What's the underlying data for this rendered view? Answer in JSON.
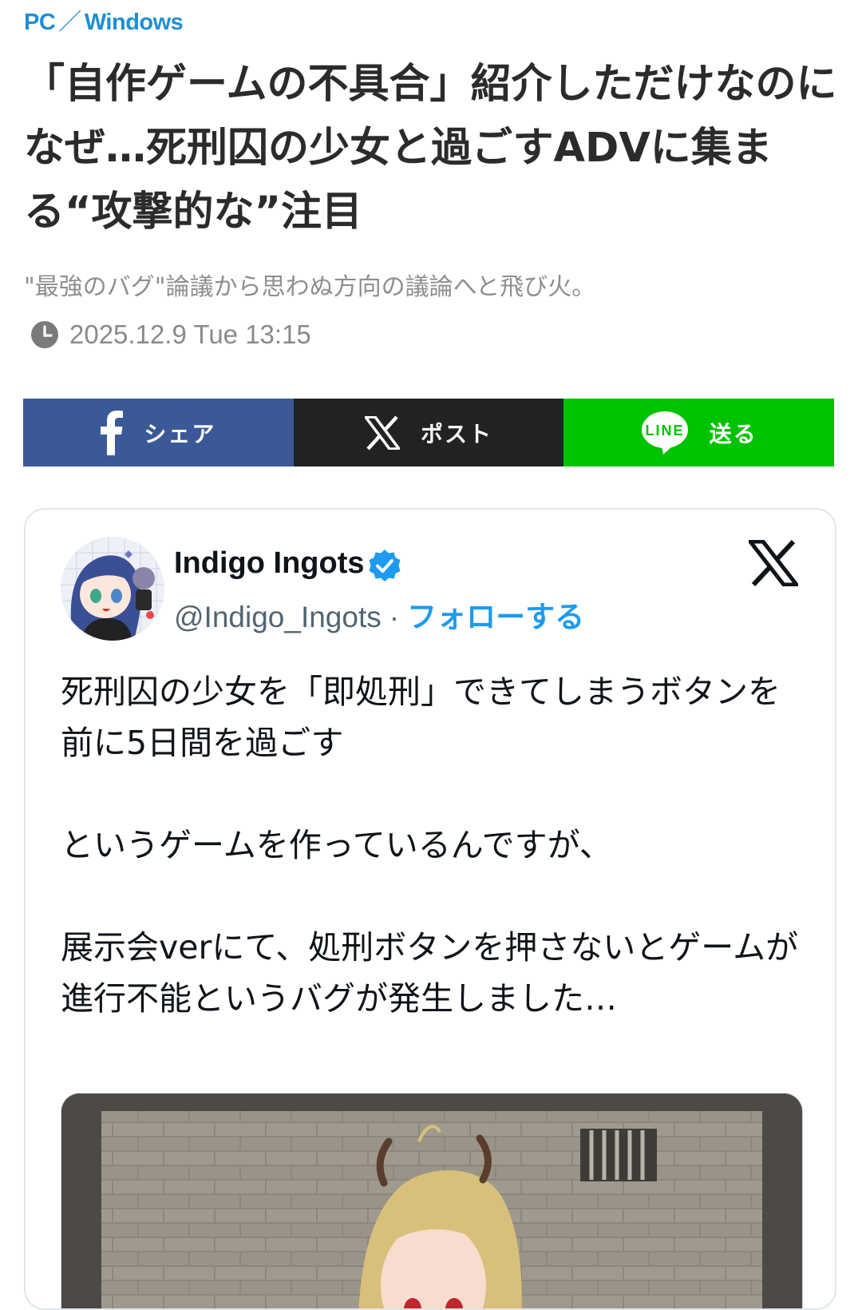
{
  "breadcrumb": {
    "category": "PC",
    "separator": "／",
    "subcategory": "Windows"
  },
  "article": {
    "title": "「自作ゲームの不具合」紹介しただけなのになぜ…死刑囚の少女と過ごすADVに集まる“攻撃的な”注目",
    "subtitle": "\"最強のバグ\"論議から思わぬ方向の議論へと飛び火。",
    "date": "2025.12.9 Tue 13:15"
  },
  "share": {
    "facebook_label": "シェア",
    "x_label": "ポスト",
    "line_label": "送る",
    "line_icon_text": "LINE"
  },
  "tweet": {
    "display_name": "Indigo Ingots",
    "handle": "@Indigo_Ingots",
    "dot": "·",
    "follow_label": "フォローする",
    "paragraph1": "死刑囚の少女を「即処刑」できてしまうボタンを前に5日間を過ごす",
    "paragraph2": "というゲームを作っているんですが、",
    "paragraph3": "展示会verにて、処刑ボタンを押さないとゲームが進行不能というバグが発生しました…"
  },
  "colors": {
    "category": "#1e8fd6",
    "facebook": "#3b5998",
    "x": "#222222",
    "line": "#00c300",
    "follow": "#1d9bf0",
    "verified": "#1d9bf0"
  },
  "icons": {
    "date": "clock-icon",
    "facebook": "facebook-icon",
    "x": "x-icon",
    "line": "line-icon",
    "verified": "verified-badge-icon"
  }
}
